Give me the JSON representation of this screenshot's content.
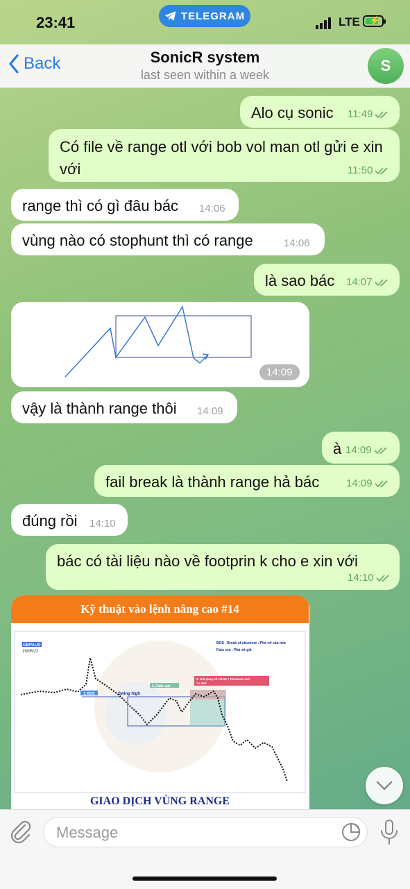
{
  "status_bar": {
    "time": "23:41",
    "center_pill": "TELEGRAM",
    "network": "LTE"
  },
  "header": {
    "back_label": "Back",
    "title": "SonicR system",
    "subtitle": "last seen within a week",
    "avatar_letter": "S"
  },
  "messages": [
    {
      "dir": "out",
      "text": "Alo cụ sonic",
      "time": "11:49"
    },
    {
      "dir": "out",
      "text": "Có file về range otl với bob vol man otl gửi e xin với",
      "time": "11:50"
    },
    {
      "dir": "in",
      "text": "range thì có gì đâu bác",
      "time": "14:06"
    },
    {
      "dir": "in",
      "text": "vùng nào có stophunt thì có range",
      "time": "14:06"
    },
    {
      "dir": "out",
      "text": "là sao bác",
      "time": "14:07"
    },
    {
      "dir": "in",
      "type": "image",
      "time": "14:09"
    },
    {
      "dir": "in",
      "text": "vậy là thành range thôi",
      "time": "14:09"
    },
    {
      "dir": "out",
      "text": "à",
      "time": "14:09"
    },
    {
      "dir": "out",
      "text": "fail break là thành range hả bác",
      "time": "14:09"
    },
    {
      "dir": "in",
      "text": "đúng rồi",
      "time": "14:10"
    },
    {
      "dir": "out",
      "text": "bác có tài liệu nào về footprin k cho e xin với",
      "time": "14:10"
    },
    {
      "dir": "in",
      "type": "image"
    }
  ],
  "doc_image": {
    "title": "Kỹ thuật vào lệnh nâng cao #14",
    "footer": "GIAO DỊCH VÙNG RANGE",
    "pair": "GBPAUD M5",
    "date": "19/06/22",
    "legend_bos": "BOS - Break of structure : Phá vỡ cấu trúc",
    "legend_fake": "Fake out : Phá vỡ giả",
    "label_bos": "1. BOS",
    "label_swing": "Swing high",
    "label_fake": "2. Fake out",
    "label_retest": "3. Giá quay về retest + Pressure sell",
    "label_sell": "=> Sell"
  },
  "composer": {
    "placeholder": "Message"
  },
  "colors": {
    "accent": "#2a7be4",
    "out_bubble": "#e2fec8",
    "in_bubble": "#ffffff",
    "check": "#5fa85c"
  }
}
